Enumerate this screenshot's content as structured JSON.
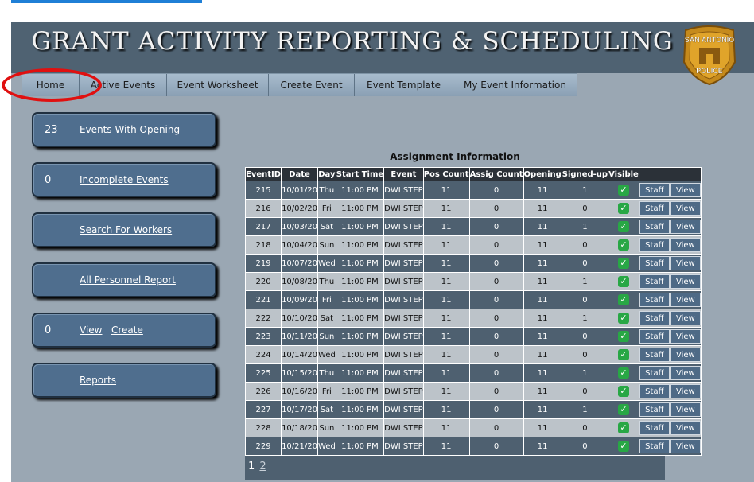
{
  "header": {
    "title": "GRANT ACTIVITY REPORTING & SCHEDULING"
  },
  "badge": {
    "line1": "SAN ANTONIO",
    "line2": "POLICE"
  },
  "nav": [
    {
      "label": "Home"
    },
    {
      "label": "Active Events"
    },
    {
      "label": "Event Worksheet"
    },
    {
      "label": "Create Event"
    },
    {
      "label": "Event Template"
    },
    {
      "label": "My Event Information"
    }
  ],
  "sidebar": {
    "events_with_opening": {
      "count": "23",
      "label": "Events With Opening"
    },
    "incomplete_events": {
      "count": "0",
      "label": "Incomplete Events"
    },
    "search_workers": {
      "label": "Search For Workers"
    },
    "all_personnel": {
      "label": "All Personnel Report"
    },
    "view_create": {
      "count": "0",
      "view": "View",
      "create": "Create"
    },
    "reports": {
      "label": "Reports"
    }
  },
  "assignment": {
    "title": "Assignment Information",
    "columns": [
      "EventID",
      "Date",
      "Day",
      "Start Time",
      "Event",
      "Pos Count",
      "Assig Count",
      "Opening",
      "Signed-up",
      "Visible",
      "",
      ""
    ],
    "staff_label": "Staff",
    "view_label": "View",
    "rows": [
      {
        "id": "215",
        "date": "10/01/20",
        "day": "Thu",
        "start": "11:00 PM",
        "event": "DWI STEP",
        "pos": "11",
        "assig": "0",
        "opening": "11",
        "signed": "1"
      },
      {
        "id": "216",
        "date": "10/02/20",
        "day": "Fri",
        "start": "11:00 PM",
        "event": "DWI STEP",
        "pos": "11",
        "assig": "0",
        "opening": "11",
        "signed": "0"
      },
      {
        "id": "217",
        "date": "10/03/20",
        "day": "Sat",
        "start": "11:00 PM",
        "event": "DWI STEP",
        "pos": "11",
        "assig": "0",
        "opening": "11",
        "signed": "1"
      },
      {
        "id": "218",
        "date": "10/04/20",
        "day": "Sun",
        "start": "11:00 PM",
        "event": "DWI STEP",
        "pos": "11",
        "assig": "0",
        "opening": "11",
        "signed": "0"
      },
      {
        "id": "219",
        "date": "10/07/20",
        "day": "Wed",
        "start": "11:00 PM",
        "event": "DWI STEP",
        "pos": "11",
        "assig": "0",
        "opening": "11",
        "signed": "0"
      },
      {
        "id": "220",
        "date": "10/08/20",
        "day": "Thu",
        "start": "11:00 PM",
        "event": "DWI STEP",
        "pos": "11",
        "assig": "0",
        "opening": "11",
        "signed": "1"
      },
      {
        "id": "221",
        "date": "10/09/20",
        "day": "Fri",
        "start": "11:00 PM",
        "event": "DWI STEP",
        "pos": "11",
        "assig": "0",
        "opening": "11",
        "signed": "0"
      },
      {
        "id": "222",
        "date": "10/10/20",
        "day": "Sat",
        "start": "11:00 PM",
        "event": "DWI STEP",
        "pos": "11",
        "assig": "0",
        "opening": "11",
        "signed": "1"
      },
      {
        "id": "223",
        "date": "10/11/20",
        "day": "Sun",
        "start": "11:00 PM",
        "event": "DWI STEP",
        "pos": "11",
        "assig": "0",
        "opening": "11",
        "signed": "0"
      },
      {
        "id": "224",
        "date": "10/14/20",
        "day": "Wed",
        "start": "11:00 PM",
        "event": "DWI STEP",
        "pos": "11",
        "assig": "0",
        "opening": "11",
        "signed": "0"
      },
      {
        "id": "225",
        "date": "10/15/20",
        "day": "Thu",
        "start": "11:00 PM",
        "event": "DWI STEP",
        "pos": "11",
        "assig": "0",
        "opening": "11",
        "signed": "1"
      },
      {
        "id": "226",
        "date": "10/16/20",
        "day": "Fri",
        "start": "11:00 PM",
        "event": "DWI STEP",
        "pos": "11",
        "assig": "0",
        "opening": "11",
        "signed": "0"
      },
      {
        "id": "227",
        "date": "10/17/20",
        "day": "Sat",
        "start": "11:00 PM",
        "event": "DWI STEP",
        "pos": "11",
        "assig": "0",
        "opening": "11",
        "signed": "1"
      },
      {
        "id": "228",
        "date": "10/18/20",
        "day": "Sun",
        "start": "11:00 PM",
        "event": "DWI STEP",
        "pos": "11",
        "assig": "0",
        "opening": "11",
        "signed": "0"
      },
      {
        "id": "229",
        "date": "10/21/20",
        "day": "Wed",
        "start": "11:00 PM",
        "event": "DWI STEP",
        "pos": "11",
        "assig": "0",
        "opening": "11",
        "signed": "0"
      }
    ]
  },
  "pager": {
    "page1": "1",
    "page2": "2"
  },
  "colors": {
    "accent_blue": "#1f7fd6",
    "header": "#4f6272",
    "highlight_circle": "#e01010",
    "opening_red": "#e02020",
    "visible_check": "#28a745"
  }
}
